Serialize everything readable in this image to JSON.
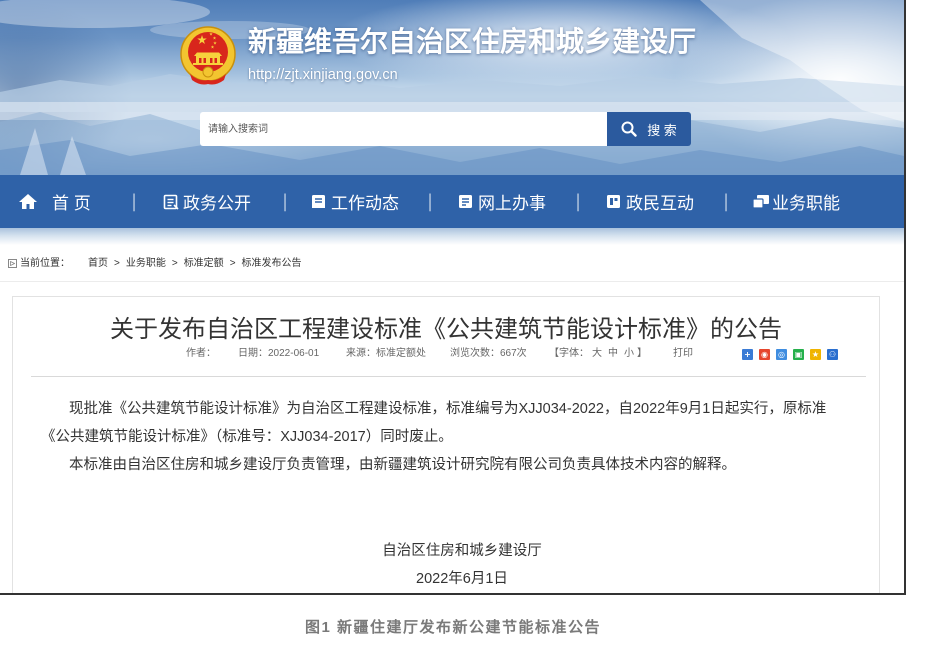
{
  "header": {
    "title": "新疆维吾尔自治区住房和城乡建设厅",
    "url": "http://zjt.xinjiang.gov.cn",
    "emblem_icon": "national-emblem-icon"
  },
  "search": {
    "placeholder": "请输入搜索词",
    "value": "",
    "button_label": "搜 索",
    "button_icon": "search-icon"
  },
  "nav": {
    "separator": "|",
    "items": [
      {
        "label": "首 页",
        "icon": "home-icon"
      },
      {
        "label": "政务公开",
        "icon": "document-icon"
      },
      {
        "label": "工作动态",
        "icon": "news-icon"
      },
      {
        "label": "网上办事",
        "icon": "service-icon"
      },
      {
        "label": "政民互动",
        "icon": "interaction-icon"
      },
      {
        "label": "业务职能",
        "icon": "function-icon"
      }
    ]
  },
  "breadcrumb": {
    "icon": "location-icon",
    "label": "当前位置：",
    "separator": ">",
    "items": [
      "首页",
      "业务职能",
      "标准定额",
      "标准发布公告"
    ]
  },
  "article": {
    "title": "关于发布自治区工程建设标准《公共建筑节能设计标准》的公告",
    "meta": {
      "author": "作者：",
      "date": "日期：2022-06-01",
      "source": "来源：标准定额处",
      "views": "浏览次数：667次",
      "font_size_prefix": "【字体：",
      "font_sizes": [
        "大",
        "中",
        "小"
      ],
      "font_size_suffix": "】",
      "print": "打印"
    },
    "share_icons": [
      "share-more-icon",
      "share-weibo-icon",
      "share-tencent-weibo-icon",
      "share-wechat-icon",
      "share-qzone-icon",
      "share-renren-icon"
    ],
    "paragraphs": [
      {
        "lines": [
          "现批准《公共建筑节能设计标准》为自治区工程建设标准，标准编号为XJJ034-2022，自2022年9月1日起实行，原标准",
          "《公共建筑节能设计标准》（标准号：XJJ034-2017）同时废止。"
        ]
      },
      {
        "lines": [
          "本标准由自治区住房和城乡建设厅负责管理，由新疆建筑设计研究院有限公司负责具体技术内容的解释。"
        ]
      }
    ],
    "signature": {
      "organization": "自治区住房和城乡建设厅",
      "date": "2022年6月1日"
    }
  },
  "caption": "图1 新疆住建厅发布新公建节能标准公告",
  "colors": {
    "nav_bg": "#2f62a8",
    "search_button_bg": "#2b5a9e",
    "title_text": "#333333",
    "body_text": "#333333",
    "meta_text": "#666666",
    "caption_text": "#7a7a7a"
  }
}
